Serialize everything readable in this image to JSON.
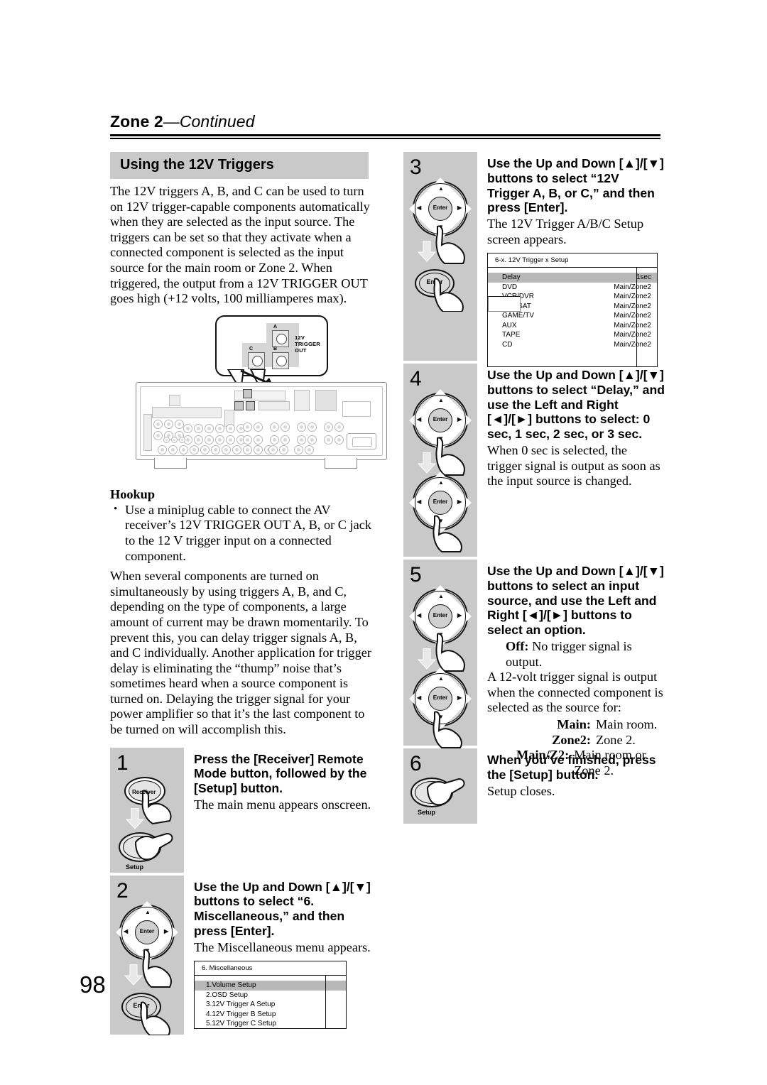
{
  "header": {
    "title_main": "Zone 2",
    "title_cont": "—Continued"
  },
  "section": {
    "heading": "Using the 12V Triggers",
    "intro": "The 12V triggers A, B, and C can be used to turn on 12V trigger-capable components automatically when they are selected as the input source. The triggers can be set so that they activate when a connected component is selected as the input source for the main room or Zone 2. When triggered, the output from a 12V TRIGGER OUT goes high (+12 volts, 100 milliamperes max)."
  },
  "figure": {
    "callout_label": "12V TRIGGER OUT",
    "jack_a": "A",
    "jack_b": "B",
    "jack_c": "C"
  },
  "hookup": {
    "heading": "Hookup",
    "bullet": "Use a miniplug cable to connect the AV receiver’s 12V TRIGGER OUT A, B, or C jack to the 12 V trigger input on a connected component.",
    "para": "When several components are turned on simultaneously by using triggers A, B, and C, depending on the type of components, a large amount of current may be drawn momentarily. To prevent this, you can delay trigger signals A, B, and C individually. Another application for trigger delay is eliminating the “thump” noise that’s sometimes heard when a source component is turned on. Delaying the trigger signal for your power amplifier so that it’s the last component to be turned on will accomplish this."
  },
  "steps": [
    {
      "number": "1",
      "title": "Press the [Receiver] Remote Mode button, followed by the [Setup] button.",
      "body": "The main menu appears onscreen.",
      "button_top_label": "Receiver",
      "button_bottom_label": "Setup"
    },
    {
      "number": "2",
      "title": "Use the Up and Down [▲]/[▼] buttons to select “6. Miscellaneous,” and then press [Enter].",
      "body": "The Miscellaneous menu appears.",
      "enter_label": "Enter"
    },
    {
      "number": "3",
      "title": "Use the Up and Down [▲]/[▼] buttons to select “12V Trigger A, B, or C,” and then press [Enter].",
      "body": "The 12V Trigger A/B/C Setup screen appears.",
      "enter_label": "Enter"
    },
    {
      "number": "4",
      "title": "Use the Up and Down [▲]/[▼] buttons to select “Delay,” and use the Left and Right [◄]/[►] buttons to select: 0 sec, 1 sec, 2 sec, or 3 sec.",
      "body": "When 0 sec is selected, the trigger signal is output as soon as the input source is changed.",
      "enter_label": "Enter"
    },
    {
      "number": "5",
      "title": "Use the Up and Down [▲]/[▼] buttons to select an input source, and use the Left and Right [◄]/[►] buttons to select an option.",
      "body": "",
      "enter_label": "Enter"
    },
    {
      "number": "6",
      "title": "When you’ve finished, press the [Setup] button.",
      "body": "Setup closes.",
      "button_bottom_label": "Setup"
    }
  ],
  "step5_options": {
    "off_term": "Off:",
    "off_desc": "No trigger signal is output.",
    "para": "A 12-volt trigger signal is output when the connected component is selected as the source for:",
    "list": [
      {
        "term": "Main:",
        "desc": "Main room."
      },
      {
        "term": "Zone2:",
        "desc": "Zone 2."
      },
      {
        "term": "Main/Z2:",
        "desc": "Main room or Zone 2."
      }
    ]
  },
  "osd_misc": {
    "title": "6. Miscellaneous",
    "items": [
      "1.Volume Setup",
      "2.OSD Setup",
      "3.12V Trigger A Setup",
      "4.12V Trigger B Setup",
      "5.12V Trigger C Setup"
    ],
    "selected_index": 0
  },
  "osd_trigger": {
    "title": "6-x. 12V Trigger x Setup",
    "rows": [
      {
        "key": "Delay",
        "value": "1sec"
      },
      {
        "key": "DVD",
        "value": "Main/Zone2"
      },
      {
        "key": "VCR/DVR",
        "value": "Main/Zone2"
      },
      {
        "key": "CBL/SAT",
        "value": "Main/Zone2"
      },
      {
        "key": "GAME/TV",
        "value": "Main/Zone2"
      },
      {
        "key": "AUX",
        "value": "Main/Zone2"
      },
      {
        "key": "TAPE",
        "value": "Main/Zone2"
      },
      {
        "key": "CD",
        "value": "Main/Zone2"
      }
    ],
    "selected_index": 0
  },
  "footer": {
    "page_number": "98"
  },
  "colors": {
    "gray_box": "#c9c9c9",
    "osd_highlight": "#b8b8b8",
    "rule": "#000000"
  }
}
